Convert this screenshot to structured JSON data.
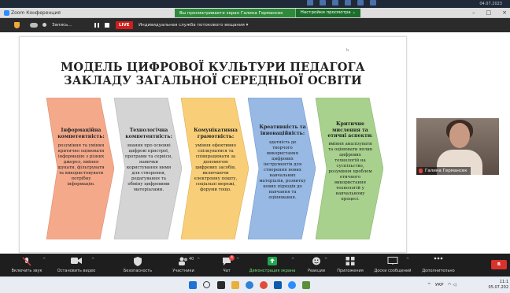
{
  "desktop": {
    "clock_top": "04.07.2023"
  },
  "titlebar": {
    "app_title": "Zoom Конференция",
    "share_banner": "Вы просматриваете экран Галина Германсек",
    "view_options": "Настройки просмотра",
    "window_controls": [
      "–",
      "□",
      "×"
    ]
  },
  "subbar": {
    "record_label": "Запись...",
    "live_badge": "LIVE",
    "stream_label": "Индивидуальная служба потокового вещания"
  },
  "slide": {
    "marker": "Ь",
    "title_line1": "МОДЕЛЬ ЦИФРОВОЇ КУЛЬТУРИ ПЕДАГОГА",
    "title_line2": "ЗАКЛАДУ ЗАГАЛЬНОЇ СЕРЕДНЬОЇ ОСВІТИ",
    "blocks": [
      {
        "color": "#f4a98b",
        "heading": "Інформаційна компетентність:",
        "body": "розуміння та уміння критично оцінювати інформацію з різних джерел, вміння шукати, фільтрувати та використовувати потрібну інформацію."
      },
      {
        "color": "#d4d4d4",
        "heading": "Технологічна компетентність:",
        "body": "знання про основні цифрові пристрої, програми та сервіси, навички користування ними для створення, редагування та обміну цифровими матеріалами."
      },
      {
        "color": "#f8cf78",
        "heading": "Комунікативна грамотність:",
        "body": "уміння ефективно спілкуватися та співпрацювати за допомогою цифрових засобів, включаючи електронну пошту, соціальні мережі, форуми тощо."
      },
      {
        "color": "#97b9e4",
        "heading": "Креативність та інноваційність:",
        "body": "здатність до творчого використання цифрових інструментів для створення нових навчальних матеріалів, розвитку нових підходів до навчання та оцінювання."
      },
      {
        "color": "#a9d18e",
        "heading": "Критичне мислення та етичні аспекти:",
        "body": "вміння аналізувати та оцінювати вплив цифрових технологій на суспільство, розуміння проблем етичного використання технологій у навчальному процесі."
      }
    ]
  },
  "video": {
    "participant_name": "Галина Германсек"
  },
  "controls": {
    "mute": "Включить звук",
    "video": "Остановить видео",
    "security": "Безопасность",
    "participants": "Участники",
    "participants_count": "40",
    "chat": "Чат",
    "chat_badge": "4",
    "share": "Демонстрация экрана",
    "reactions": "Реакции",
    "apps": "Приложения",
    "whiteboards": "Доски сообщений",
    "more": "Дополнительно",
    "end": "В"
  },
  "taskbar": {
    "lang": "УКР",
    "time": "11:1",
    "date": "05.07.202"
  }
}
